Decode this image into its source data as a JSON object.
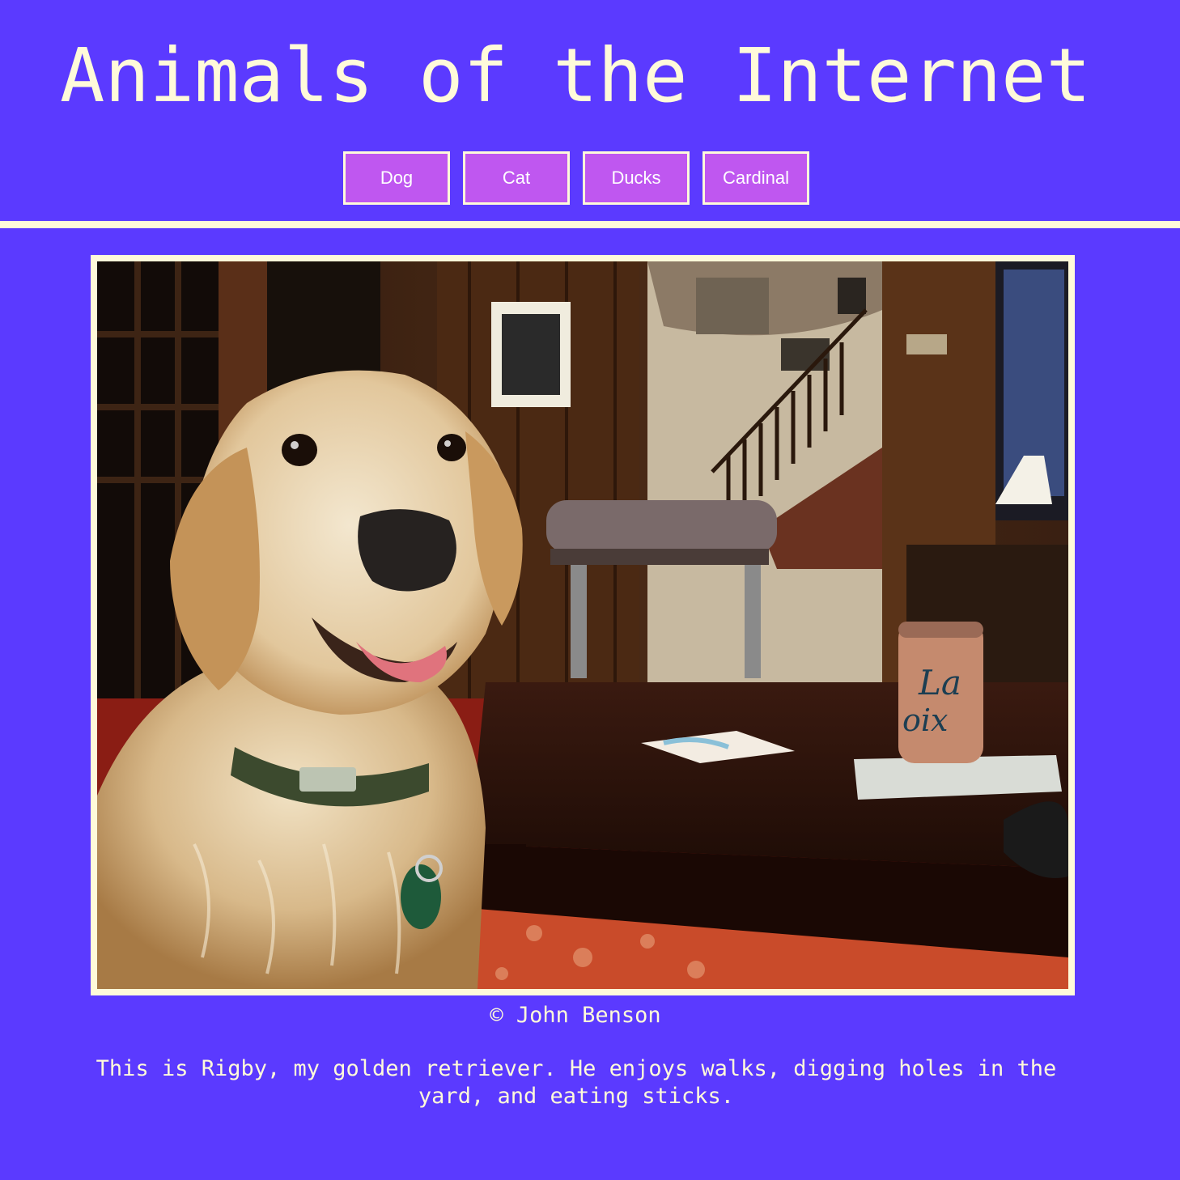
{
  "page": {
    "title": "Animals of the Internet",
    "background_color": "#5b3aff",
    "text_color": "#fffada"
  },
  "nav": {
    "button_color": "#bf57f0",
    "buttons": [
      {
        "label": "Dog"
      },
      {
        "label": "Cat"
      },
      {
        "label": "Ducks"
      },
      {
        "label": "Cardinal"
      }
    ]
  },
  "photo": {
    "subject": "golden retriever sitting in a living room"
  },
  "caption": "© John Benson",
  "description": "This is Rigby, my golden retriever. He enjoys walks, digging holes in the yard, and eating sticks."
}
